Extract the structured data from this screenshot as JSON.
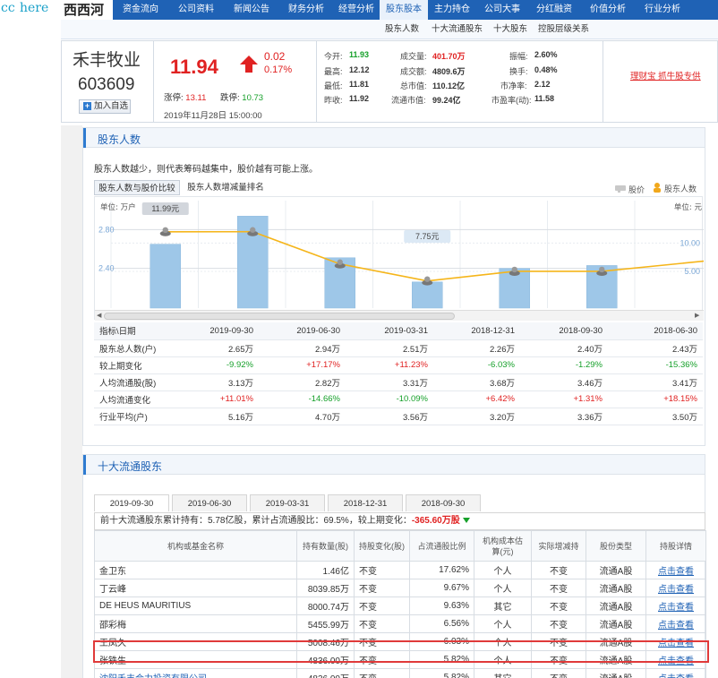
{
  "brand": {
    "cc": "cc",
    "here": "here",
    "site": "西西河"
  },
  "nav": {
    "items": [
      "资金流向",
      "公司资料",
      "新闻公告",
      "财务分析",
      "经营分析",
      "股东股本",
      "主力持仓",
      "公司大事",
      "分红融资",
      "价值分析",
      "行业分析"
    ],
    "active": "股东股本"
  },
  "subnav": {
    "items": [
      "股东人数",
      "十大流通股东",
      "十大股东",
      "控股层级关系"
    ]
  },
  "quote": {
    "name": "禾丰牧业",
    "code": "603609",
    "add_watch": "加入自选",
    "price": "11.94",
    "change": "0.02",
    "change_pct": "0.17%",
    "limit_up_label": "涨停:",
    "limit_up": "13.11",
    "limit_down_label": "跌停:",
    "limit_down": "10.73",
    "datetime": "2019年11月28日 15:00:00",
    "stats": {
      "open_label": "今开:",
      "open": "11.93",
      "high_label": "最高:",
      "high": "12.12",
      "low_label": "最低:",
      "low": "11.81",
      "prev_label": "昨收:",
      "prev": "11.92",
      "volume_label": "成交量:",
      "volume": "401.70万",
      "amount_label": "成交额:",
      "amount": "4809.6万",
      "mktcap_label": "总市值:",
      "mktcap": "110.12亿",
      "float_label": "流通市值:",
      "float": "99.24亿",
      "amp_label": "振幅:",
      "amp": "2.60%",
      "turnover_label": "换手:",
      "turnover": "0.48%",
      "pb_label": "市净率:",
      "pb": "2.12",
      "pe_label": "市盈率(动):",
      "pe": "11.58"
    },
    "promo_link": "理财宝 抓牛股专供"
  },
  "holders_panel": {
    "title": "股东人数",
    "hint": "股东人数越少，则代表筹码越集中，股价越有可能上涨。",
    "tab_compare": "股东人数与股价比较",
    "tab_rank": "股东人数增减量排名",
    "legend_price": "股价",
    "legend_holders": "股东人数",
    "unit_left": "单位: 万户",
    "unit_right": "单位: 元",
    "table_header": "指标\\日期",
    "dates": [
      "2019-09-30",
      "2019-06-30",
      "2019-03-31",
      "2018-12-31",
      "2018-09-30",
      "2018-06-30"
    ],
    "rows": [
      {
        "label": "股东总人数(户)",
        "values": [
          "2.65万",
          "2.94万",
          "2.51万",
          "2.26万",
          "2.40万",
          "2.43万"
        ],
        "tone": ""
      },
      {
        "label": "较上期变化",
        "values": [
          "-9.92%",
          "+17.17%",
          "+11.23%",
          "-6.03%",
          "-1.29%",
          "-15.36%"
        ],
        "tone": "chg"
      },
      {
        "label": "人均流通股(股)",
        "values": [
          "3.13万",
          "2.82万",
          "3.31万",
          "3.68万",
          "3.46万",
          "3.41万"
        ],
        "tone": ""
      },
      {
        "label": "人均流通变化",
        "values": [
          "+11.01%",
          "-14.66%",
          "-10.09%",
          "+6.42%",
          "+1.31%",
          "+18.15%"
        ],
        "tone": "chg"
      },
      {
        "label": "行业平均(户)",
        "values": [
          "5.16万",
          "4.70万",
          "3.56万",
          "3.20万",
          "3.36万",
          "3.50万"
        ],
        "tone": ""
      }
    ]
  },
  "chart_data": {
    "type": "bar",
    "categories": [
      "2019-09-30",
      "2019-06-30",
      "2019-03-31",
      "2018-12-31",
      "2018-09-30",
      "2018-06-30"
    ],
    "series": [
      {
        "name": "股东人数",
        "values": [
          2.65,
          2.94,
          2.51,
          2.26,
          2.4,
          2.43
        ],
        "axis": "left",
        "color": "#9ec7e8"
      },
      {
        "name": "股价",
        "values": [
          11.99,
          12.0,
          6.3,
          3.3,
          5.0,
          5.0
        ],
        "axis": "right",
        "color": "#f5b51a",
        "type": "line"
      }
    ],
    "y_ticks_left": [
      "2.80",
      "2.40"
    ],
    "y_ticks_right": [
      "10.00",
      "5.00"
    ],
    "callouts": [
      "11.99元",
      "7.75元"
    ],
    "ylim_left": [
      1.99,
      3.1
    ],
    "ylim_right": [
      -1.5,
      17.5
    ],
    "grid": true
  },
  "top10_panel": {
    "title": "十大流通股东",
    "tabs": [
      "2019-09-30",
      "2019-06-30",
      "2019-03-31",
      "2018-12-31",
      "2018-09-30"
    ],
    "summary_prefix": "前十大流通股东累计持有：5.78亿股，累计占流通股比：69.5%，较上期变化：",
    "summary_change": "-365.60万股",
    "headers": [
      "机构或基金名称",
      "持有数量(股)",
      "持股变化(股)",
      "占流通股比例",
      "机构成本估算(元)",
      "实际增减持",
      "股份类型",
      "持股详情"
    ],
    "rows": [
      {
        "name": "金卫东",
        "qty": "1.46亿",
        "chg": "不变",
        "ratio": "17.62%",
        "cost": "个人",
        "actual": "不变",
        "type": "流通A股",
        "detail": "点击查看",
        "link": false
      },
      {
        "name": "丁云峰",
        "qty": "8039.85万",
        "chg": "不变",
        "ratio": "9.67%",
        "cost": "个人",
        "actual": "不变",
        "type": "流通A股",
        "detail": "点击查看",
        "link": false
      },
      {
        "name": "DE HEUS MAURITIUS",
        "qty": "8000.74万",
        "chg": "不变",
        "ratio": "9.63%",
        "cost": "其它",
        "actual": "不变",
        "type": "流通A股",
        "detail": "点击查看",
        "link": false
      },
      {
        "name": "邵彩梅",
        "qty": "5455.99万",
        "chg": "不变",
        "ratio": "6.56%",
        "cost": "个人",
        "actual": "不变",
        "type": "流通A股",
        "detail": "点击查看",
        "link": false
      },
      {
        "name": "王凤久",
        "qty": "5008.46万",
        "chg": "不变",
        "ratio": "6.03%",
        "cost": "个人",
        "actual": "不变",
        "type": "流通A股",
        "detail": "点击查看",
        "link": false
      },
      {
        "name": "张铁生",
        "qty": "4836.00万",
        "chg": "不变",
        "ratio": "5.82%",
        "cost": "个人",
        "actual": "不变",
        "type": "流通A股",
        "detail": "点击查看",
        "link": false
      },
      {
        "name": "沈阳禾丰合力投资有限公司",
        "qty": "4836.00万",
        "chg": "不变",
        "ratio": "5.82%",
        "cost": "其它",
        "actual": "不变",
        "type": "流通A股",
        "detail": "点击查看",
        "link": true
      }
    ]
  }
}
